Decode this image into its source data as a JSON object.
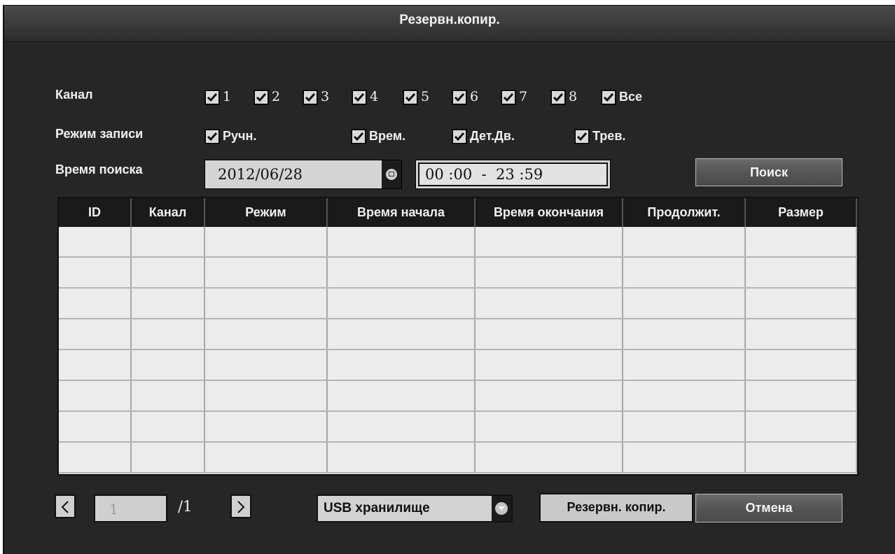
{
  "window": {
    "title": "Резервн.копир."
  },
  "filters": {
    "channel_label": "Канал",
    "channels": [
      {
        "label": "1",
        "checked": true
      },
      {
        "label": "2",
        "checked": true
      },
      {
        "label": "3",
        "checked": true
      },
      {
        "label": "4",
        "checked": true
      },
      {
        "label": "5",
        "checked": true
      },
      {
        "label": "6",
        "checked": true
      },
      {
        "label": "7",
        "checked": true
      },
      {
        "label": "8",
        "checked": true
      },
      {
        "label": "Все",
        "checked": true
      }
    ],
    "record_mode_label": "Режим записи",
    "modes": [
      {
        "label": "Ручн.",
        "checked": true
      },
      {
        "label": "Врем.",
        "checked": true
      },
      {
        "label": "Дет.Дв.",
        "checked": true
      },
      {
        "label": "Трев.",
        "checked": true
      }
    ],
    "search_time_label": "Время поиска",
    "date": "2012/06/28",
    "time_range": "00 :00  -  23 :59",
    "search_button": "Поиск"
  },
  "table": {
    "columns": [
      "ID",
      "Канал",
      "Режим",
      "Время начала",
      "Время окончания",
      "Продолжит.",
      "Размер"
    ],
    "rows": [
      [],
      [],
      [],
      [],
      [],
      [],
      [],
      []
    ]
  },
  "pagination": {
    "current_page": "1",
    "total": "/1"
  },
  "storage": {
    "selected": "USB хранилище"
  },
  "actions": {
    "backup_button": "Резервн. копир.",
    "cancel_button": "Отмена"
  },
  "colors": {
    "background": "#262626",
    "grid_cell": "#ececec",
    "header": "#1a1a1a"
  }
}
